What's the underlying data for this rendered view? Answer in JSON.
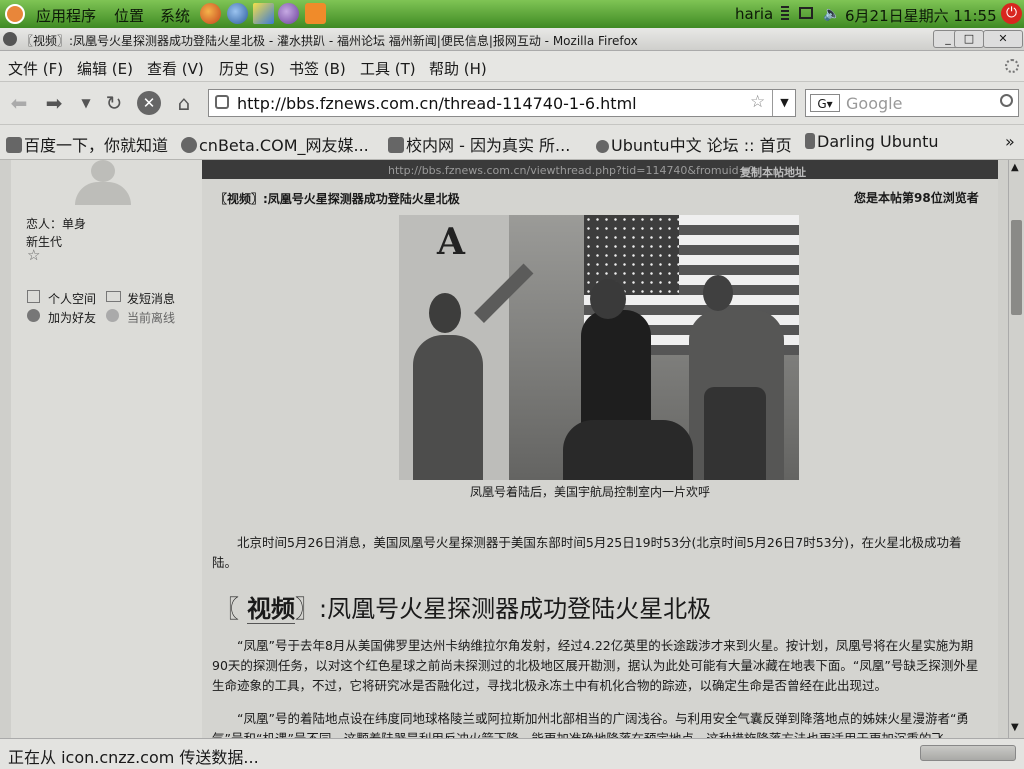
{
  "panel": {
    "menus": [
      "应用程序",
      "位置",
      "系统"
    ],
    "username": "haria",
    "datetime": "6月21日星期六 11:55"
  },
  "window": {
    "title": "〖视频〗:凤凰号火星探测器成功登陆火星北极 - 灌水拱趴 - 福州论坛 福州新闻|便民信息|报网互动 - Mozilla Firefox",
    "btn_min": "_",
    "btn_max": "□",
    "btn_close": "✕"
  },
  "menubar": [
    "文件 (F)",
    "编辑 (E)",
    "查看 (V)",
    "历史 (S)",
    "书签 (B)",
    "工具 (T)",
    "帮助 (H)"
  ],
  "nav": {
    "url": "http://bbs.fznews.com.cn/thread-114740-1-6.html",
    "search_placeholder": "Google"
  },
  "bookmarks": [
    "百度一下，你就知道",
    "cnBeta.COM_网友媒...",
    "校内网 - 因为真实 所...",
    "Ubuntu中文 论坛 :: 首页",
    "Darling Ubuntu"
  ],
  "bookmarks_overflow": "»",
  "user": {
    "relationship": "恋人：单身",
    "rank": "新生代",
    "space": "个人空间",
    "message": "发短消息",
    "add_friend": "加为好友",
    "status": "当前离线"
  },
  "post": {
    "header_url": "http://bbs.fznews.com.cn/viewthread.php?tid=114740&fromuid=0",
    "copy_link": "复制本帖地址",
    "title": "〖视频〗:凤凰号火星探测器成功登陆火星北极",
    "viewer": "您是本帖第98位浏览者",
    "caption": "凤凰号着陆后，美国宇航局控制室内一片欢呼",
    "heading_bracket": "〖",
    "heading_tag": "视频",
    "heading_rest": "〗:凤凰号火星探测器成功登陆火星北极",
    "p1": "北京时间5月26日消息，美国凤凰号火星探测器于美国东部时间5月25日19时53分(北京时间5月26日7时53分)，在火星北极成功着陆。",
    "p2": "“凤凰”号于去年8月从美国佛罗里达州卡纳维拉尔角发射，经过4.22亿英里的长途跋涉才来到火星。按计划，凤凰号将在火星实施为期90天的探测任务，以对这个红色星球之前尚未探测过的北极地区展开勘测，据认为此处可能有大量冰藏在地表下面。“凤凰”号缺乏探测外星生命迹象的工具，不过，它将研究冰是否融化过，寻找北极永冻土中有机化合物的踪迹，以确定生命是否曾经在此出现过。",
    "p3": "“凤凰”号的着陆地点设在纬度同地球格陵兰或阿拉斯加州北部相当的广阔浅谷。与利用安全气囊反弹到降落地点的姊妹火星漫游者“勇气”号和“机遇”号不同，这颗着陆器是利用反冲火箭下降，能更加准确地降落在预定地点，这种措施降落方法也更适用于更加沉重的飞"
  },
  "status": "正在从 icon.cnzz.com 传送数据..."
}
